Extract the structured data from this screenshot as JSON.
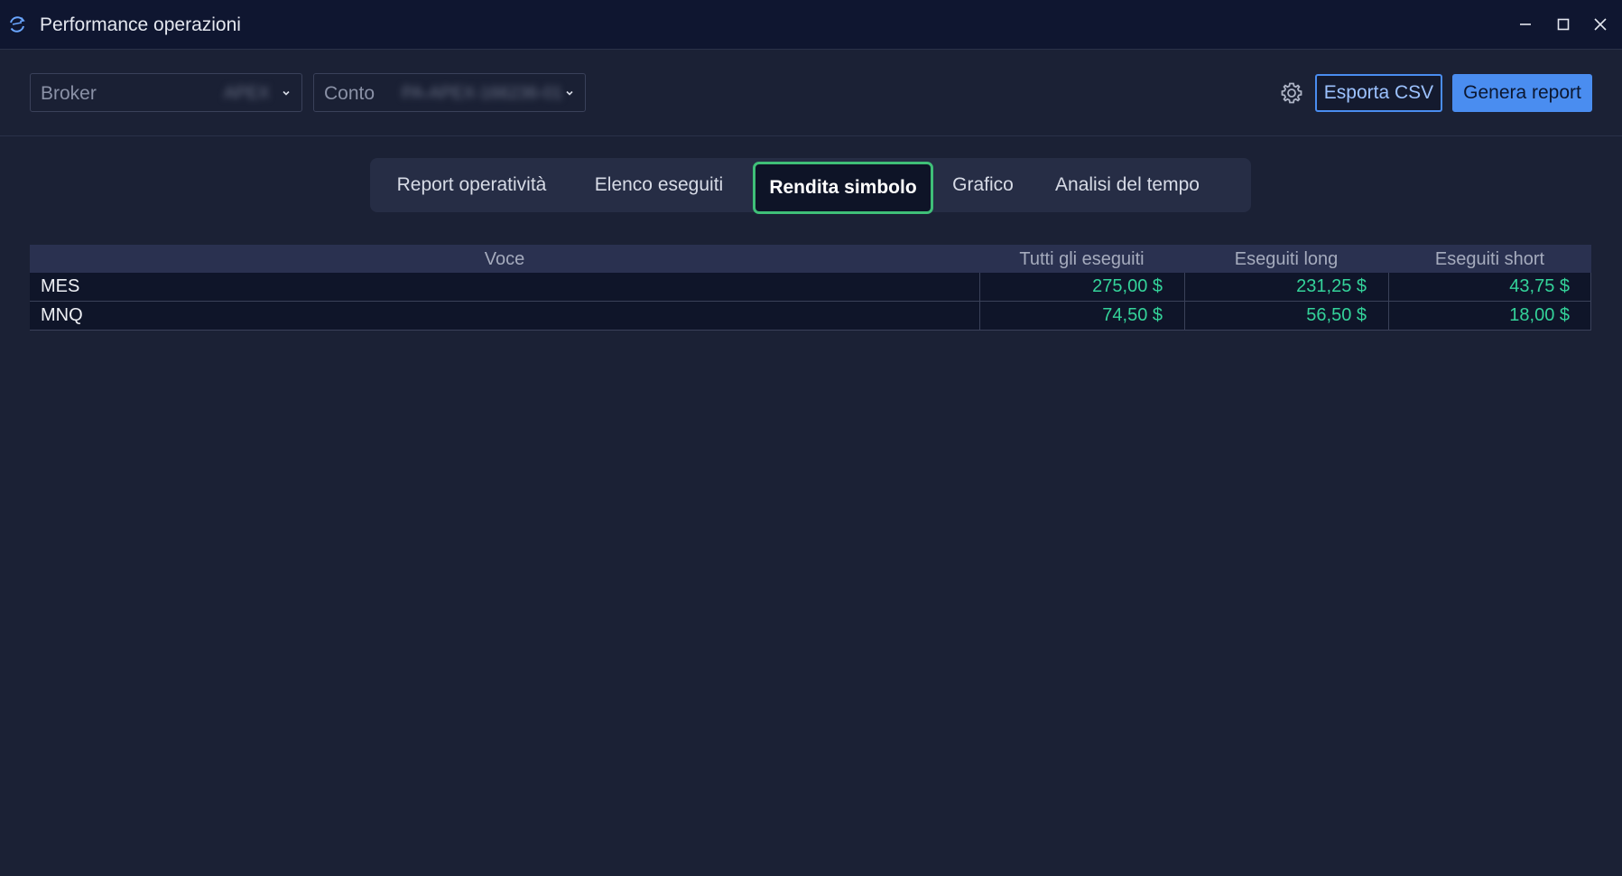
{
  "window": {
    "title": "Performance operazioni",
    "icon": "app-sync-icon"
  },
  "toolbar": {
    "broker": {
      "label": "Broker",
      "value": "APEX"
    },
    "conto": {
      "label": "Conto",
      "value": "PA-APEX-166236-01"
    },
    "settings_icon": "gear-icon",
    "export_label": "Esporta CSV",
    "report_label": "Genera report"
  },
  "tabs": [
    {
      "label": "Report operatività",
      "active": false
    },
    {
      "label": "Elenco eseguiti",
      "active": false
    },
    {
      "label": "Rendita simbolo",
      "active": true
    },
    {
      "label": "Grafico",
      "active": false
    },
    {
      "label": "Analisi del tempo",
      "active": false
    }
  ],
  "table": {
    "headers": {
      "voce": "Voce",
      "all": "Tutti gli eseguiti",
      "long": "Eseguiti long",
      "short": "Eseguiti short"
    },
    "rows": [
      {
        "voce": "MES",
        "all": "275,00 $",
        "long": "231,25 $",
        "short": "43,75 $"
      },
      {
        "voce": "MNQ",
        "all": "74,50 $",
        "long": "56,50 $",
        "short": "18,00 $"
      }
    ]
  },
  "colors": {
    "background": "#1b2135",
    "titlebar": "#0f1630",
    "accent": "#4a8df0",
    "active_tab_border": "#3fbf78",
    "positive_value": "#34d39a"
  }
}
